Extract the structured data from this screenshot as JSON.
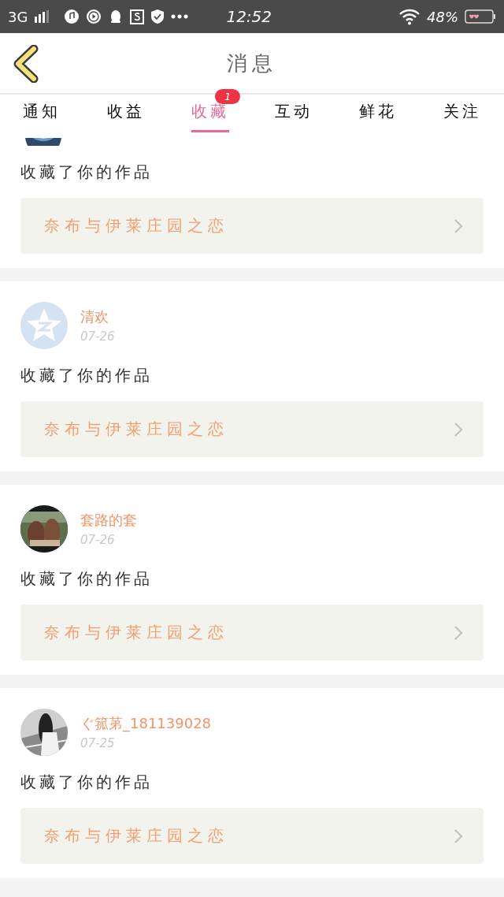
{
  "status_bar": {
    "network": "3G",
    "time": "12:52",
    "battery": "48%"
  },
  "header": {
    "title": "消息"
  },
  "tabs": [
    {
      "label": "通知",
      "selected": false
    },
    {
      "label": "收益",
      "selected": false
    },
    {
      "label": "收藏",
      "selected": true,
      "badge": "1"
    },
    {
      "label": "互动",
      "selected": false
    },
    {
      "label": "鲜花",
      "selected": false
    },
    {
      "label": "关注",
      "selected": false
    }
  ],
  "messages": [
    {
      "kind": "partial",
      "text": "收藏了你的作品",
      "work": "奈布与伊莱庄园之恋"
    },
    {
      "kind": "default",
      "name": "清欢",
      "date": "07-26",
      "text": "收藏了你的作品",
      "work": "奈布与伊莱庄园之恋"
    },
    {
      "name": "套路的套",
      "date": "07-26",
      "text": "收藏了你的作品",
      "work": "奈布与伊莱庄园之恋"
    },
    {
      "name": "ぐ箛苐_181139028",
      "date": "07-25",
      "text": "收藏了你的作品",
      "work": "奈布与伊莱庄园之恋"
    }
  ]
}
